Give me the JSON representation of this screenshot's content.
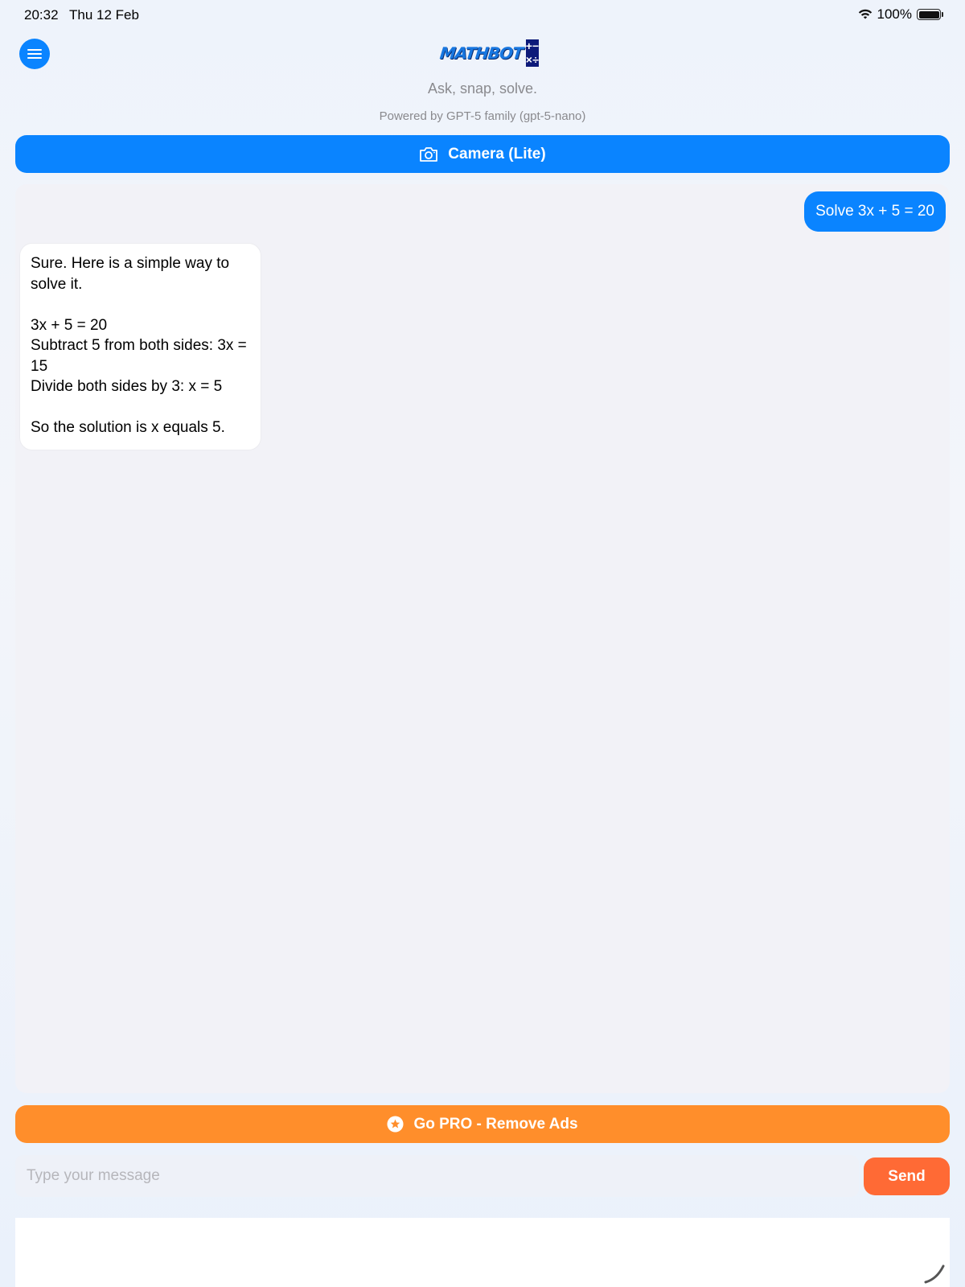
{
  "status_bar": {
    "time": "20:32",
    "date": "Thu 12 Feb",
    "battery": "100%",
    "wifi_icon": "wifi-icon",
    "battery_icon": "battery-icon"
  },
  "header": {
    "menu_icon": "hamburger-menu-icon",
    "logo": {
      "text": "MATHBOT",
      "symbols": [
        "+",
        "−",
        "×",
        "÷"
      ]
    },
    "tagline": "Ask, snap, solve.",
    "powered_by": "Powered by GPT-5 family (gpt-5-nano)"
  },
  "camera_button": {
    "label": "Camera (Lite)",
    "icon": "camera-icon"
  },
  "chat": {
    "messages": [
      {
        "role": "user",
        "text": "Solve 3x + 5 = 20"
      },
      {
        "role": "assistant",
        "text": "Sure. Here is a simple way to solve it.\n\n3x + 5 = 20\nSubtract 5 from both sides: 3x = 15\nDivide both sides by 3: x = 5\n\nSo the solution is x equals 5."
      }
    ]
  },
  "pro_button": {
    "label": "Go PRO - Remove Ads",
    "icon": "star-circle-icon"
  },
  "composer": {
    "placeholder": "Type your message",
    "value": "",
    "send_label": "Send"
  },
  "colors": {
    "primary_blue": "#0a84ff",
    "pro_orange": "#ff8e2b",
    "send_orange": "#ff6a35",
    "chat_background": "#f2f2f7"
  }
}
